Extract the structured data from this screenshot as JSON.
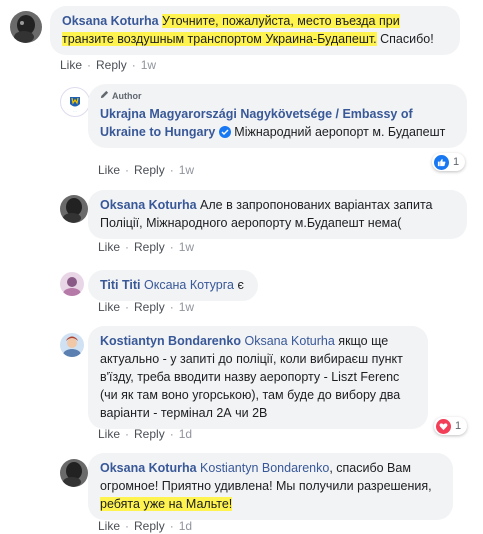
{
  "actions": {
    "like": "Like",
    "reply": "Reply",
    "sep": "·"
  },
  "comments": [
    {
      "author": "Oksana Koturha",
      "text_hl": "Уточните, пожалуйста, место въезда при транзите воздушным транспортом Украина-Будапешт.",
      "text": " Спасибо!",
      "time": "1w"
    },
    {
      "author_tag": "Author",
      "author": "Ukrajna Magyarországi Nagykövetsége / Embassy of Ukraine to Hungary",
      "text": "Міжнародний аеропорт м. Будапешт",
      "time": "1w",
      "reaction_count": "1"
    },
    {
      "author": "Oksana Koturha",
      "text": "Але в запропонованих варіантах запита Поліції, Міжнародного аеропорту м.Будапешт нема(",
      "time": "1w"
    },
    {
      "author": "Titi Titi",
      "mention": "Оксана Котурга",
      "text": " є",
      "time": "1w"
    },
    {
      "author": "Kostiantyn Bondarenko",
      "mention": "Oksana Koturha",
      "text": " якщо ще актуально - у запиті до поліції, коли вибираєш пункт в'їзду, треба вводити назву аеропорту - Liszt Ferenc (чи як там воно угорською), там буде до вибору два варіанти - термінал 2А чи 2В",
      "time": "1d",
      "reaction_count": "1"
    },
    {
      "author": "Oksana Koturha",
      "mention": "Kostiantyn Bondarenko",
      "text": ", спасибо Вам огромное! Приятно удивлена! Мы получили разрешения,",
      "text_hl": "ребята уже на Мальте!",
      "time": "1d"
    }
  ],
  "colors": {
    "name": "#385898",
    "highlight": "#fff34f",
    "bubble": "#f2f3f5",
    "like_blue": "#1877f2",
    "love_red": "#f33e58"
  }
}
